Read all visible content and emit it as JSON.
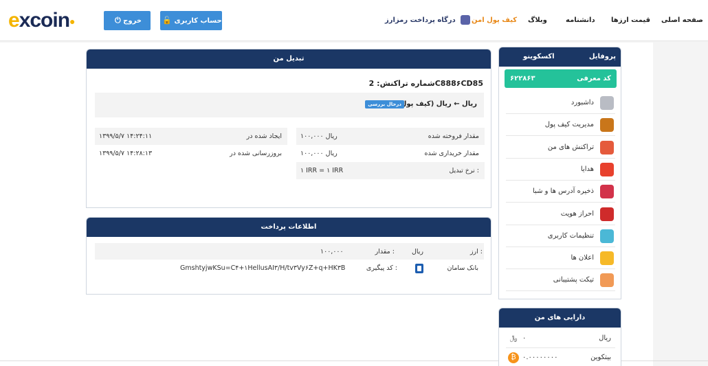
{
  "header": {
    "logo": "excoino",
    "logout_label": "خروج",
    "account_label": "حساب کاربری",
    "nav": {
      "home": "صفحه اصلی",
      "prices": "قیمت ارزها",
      "academy": "دانشنامه",
      "blog": "وبلاگ",
      "wallet": "کیف پول امن",
      "gateway": "درگاه پرداخت رمزارز"
    },
    "active_color": "#e8891a",
    "button_color": "#3d8ed8"
  },
  "exchange": {
    "title": "تبدیل من",
    "tx_label": "شماره تراکنش:",
    "tx_id": "2C888۶CD85",
    "pair": "ریال ← ریال (کیف پول)",
    "status_badge": "درحال بررسی",
    "sold_label": "مقدار فروخته شده",
    "sold_value": "ریال ۱۰۰,۰۰۰",
    "bought_label": "مقدار خریداری شده",
    "bought_value": "ریال ۱۰۰,۰۰۰",
    "rate_label": "نرخ تبدیل :",
    "rate_value": "۱ IRR = ۱ IRR",
    "created_label": "ایجاد شده در",
    "created_value": "۱۳۹۹/۵/۷ ۱۴:۲۴:۱۱",
    "updated_label": "بروزرسانی شده در",
    "updated_value": "۱۳۹۹/۵/۷ ۱۴:۲۸:۱۳"
  },
  "payment": {
    "title": "اطلاعات پرداخت",
    "currency_label": "ارز :",
    "currency_value": "ریال",
    "amount_label": "مقدار :",
    "amount_value": "۱۰۰,۰۰۰",
    "bank_name": "بانک سامان",
    "tracking_label": "کد پیگیری :",
    "tracking_value": "GmshtyjwKSu=C۴+۱HellusAI۳/H/tv۳Vy۶Z+q+HK۳B"
  },
  "profile": {
    "title": "پروفایل",
    "username": "اکسکوینو",
    "ref_label": "کد معرفی",
    "ref_code": "۶۲۲۸۶۳",
    "ref_color": "#24c29a",
    "menu": [
      {
        "label": "داشبورد",
        "icon": "dashboard-icon",
        "color": "#b9bcc4"
      },
      {
        "label": "مدیریت کیف پول",
        "icon": "wallet-icon",
        "color": "#c9761a"
      },
      {
        "label": "تراکنش های من",
        "icon": "transactions-icon",
        "color": "#e55a3c"
      },
      {
        "label": "هدایا",
        "icon": "gift-icon",
        "color": "#e8412d"
      },
      {
        "label": "ذخیره آدرس ها و شبا",
        "icon": "save-icon",
        "color": "#d2324a"
      },
      {
        "label": "احراز هویت",
        "icon": "user-verify-icon",
        "color": "#cf2b2b"
      },
      {
        "label": "تنظیمات کاربری",
        "icon": "settings-icon",
        "color": "#4bb8d6"
      },
      {
        "label": "اعلان ها",
        "icon": "bell-icon",
        "color": "#f6b928"
      },
      {
        "label": "تیکت پشتیبانی",
        "icon": "support-icon",
        "color": "#f19a56"
      }
    ]
  },
  "assets": {
    "title": "دارایی های من",
    "items": [
      {
        "label": "ریال",
        "value": "۰",
        "icon": "rial-icon",
        "symbol": "﷼",
        "color": "#ffffff"
      },
      {
        "label": "بیتکوین",
        "value": "۰.۰۰۰۰۰۰۰۰",
        "icon": "bitcoin-icon",
        "symbol": "₿",
        "color": "#f7931a"
      }
    ]
  }
}
